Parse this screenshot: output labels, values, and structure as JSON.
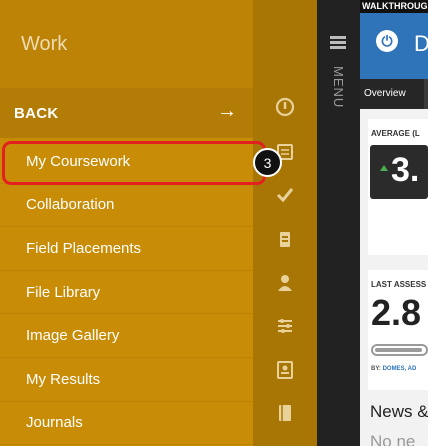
{
  "nav": {
    "title": "Work",
    "back_label": "BACK",
    "back_arrow": "→",
    "items": [
      {
        "label": "My Coursework"
      },
      {
        "label": "Collaboration"
      },
      {
        "label": "Field Placements"
      },
      {
        "label": "File Library"
      },
      {
        "label": "Image Gallery"
      },
      {
        "label": "My Results"
      },
      {
        "label": "Journals"
      }
    ]
  },
  "callout": {
    "step": "3"
  },
  "icon_strip": [
    "dashboard-icon",
    "coursework-icon",
    "checkmark-icon",
    "field-placements-icon",
    "people-icon",
    "settings-icon",
    "results-icon",
    "journals-icon"
  ],
  "menu": {
    "label": "MENU"
  },
  "app": {
    "walkthrough_label": "WALKTHROUG",
    "header_letter": "D",
    "tab_overview": "Overview",
    "card1_label": "AVERAGE (L",
    "card1_value": "3.",
    "card2_label": "LAST ASSESS",
    "card2_value": "2.8",
    "card2_progress": 0.95,
    "by_prefix": "BY:",
    "by_names": "DOMES, AD",
    "news_label": "News &",
    "no_label": "No ne"
  },
  "colors": {
    "nav_bg": "#c98c06",
    "back_bg": "#b37c06",
    "icon_strip_bg": "#a87605",
    "app_bar_bg": "#2f74b8",
    "highlight_border": "#e22020"
  }
}
